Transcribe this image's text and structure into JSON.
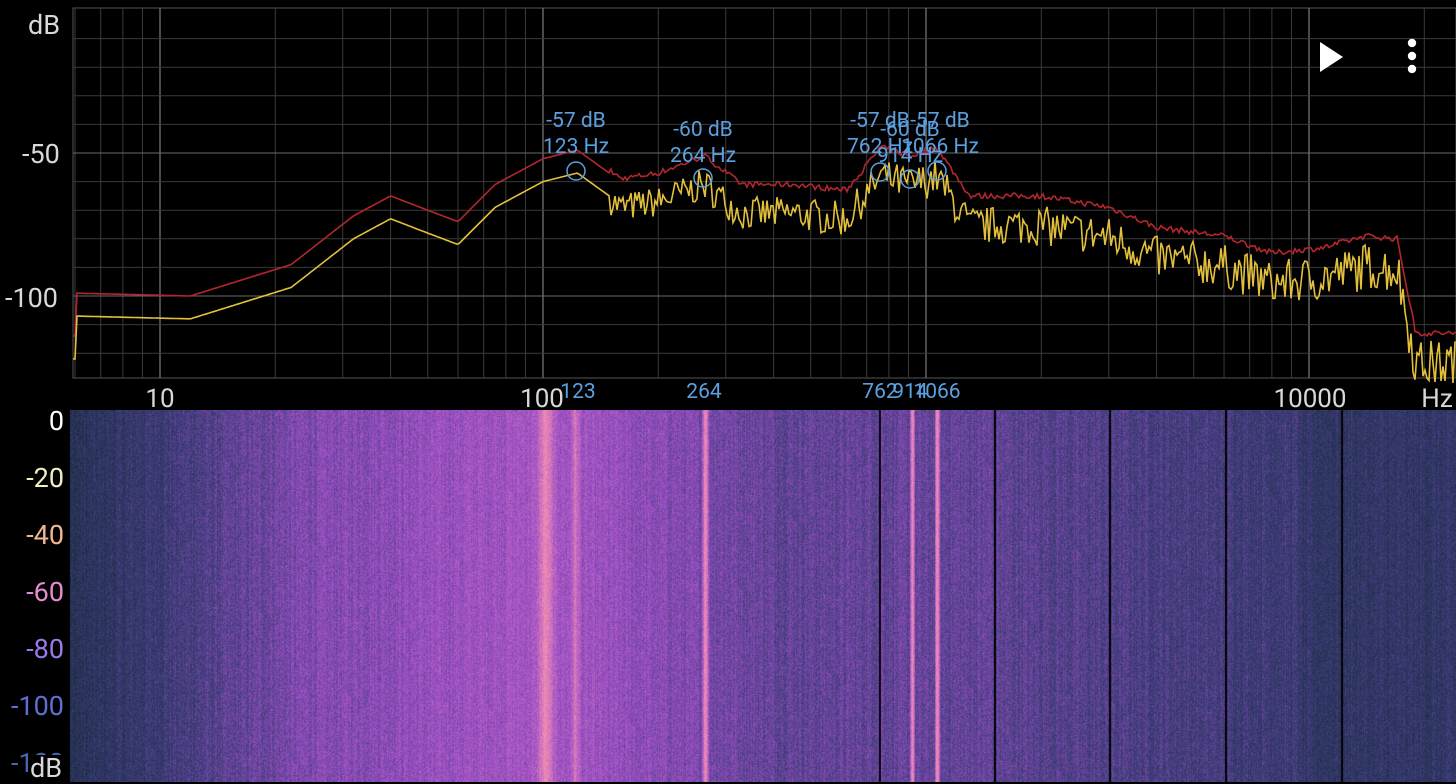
{
  "spectrum": {
    "y_unit": "dB",
    "y_ticks": [
      "-50",
      "-100"
    ],
    "x_ticks": [
      "10",
      "100",
      "10000"
    ],
    "x_unit": "Hz",
    "peaks": [
      {
        "db": "-57 dB",
        "hz_label": "123 Hz",
        "axis": "123"
      },
      {
        "db": "-60 dB",
        "hz_label": "264 Hz",
        "axis": "264"
      },
      {
        "db": "-57 dB",
        "hz_label": "762 Hz",
        "axis": "762"
      },
      {
        "db": "-60 dB",
        "hz_label": "914 Hz",
        "axis": "914"
      },
      {
        "db": "-57 dB",
        "hz_label": "1066 Hz",
        "axis": "1066"
      }
    ],
    "colors": {
      "current": "#e3c03c",
      "peak_hold": "#b3262e",
      "peak_marker": "#5aa0e0"
    }
  },
  "spectrogram": {
    "scale_ticks": [
      "0",
      "-20",
      "-40",
      "-60",
      "-80",
      "-100",
      "-120"
    ],
    "scale_colors": [
      "#ffffff",
      "#f3eec0",
      "#f0b890",
      "#e48ccf",
      "#9a7ae8",
      "#5f6fd6",
      "#4a64b8"
    ],
    "unit": "dB"
  },
  "toolbar": {
    "play_icon": "play-icon",
    "menu_icon": "more-vert-icon"
  }
}
